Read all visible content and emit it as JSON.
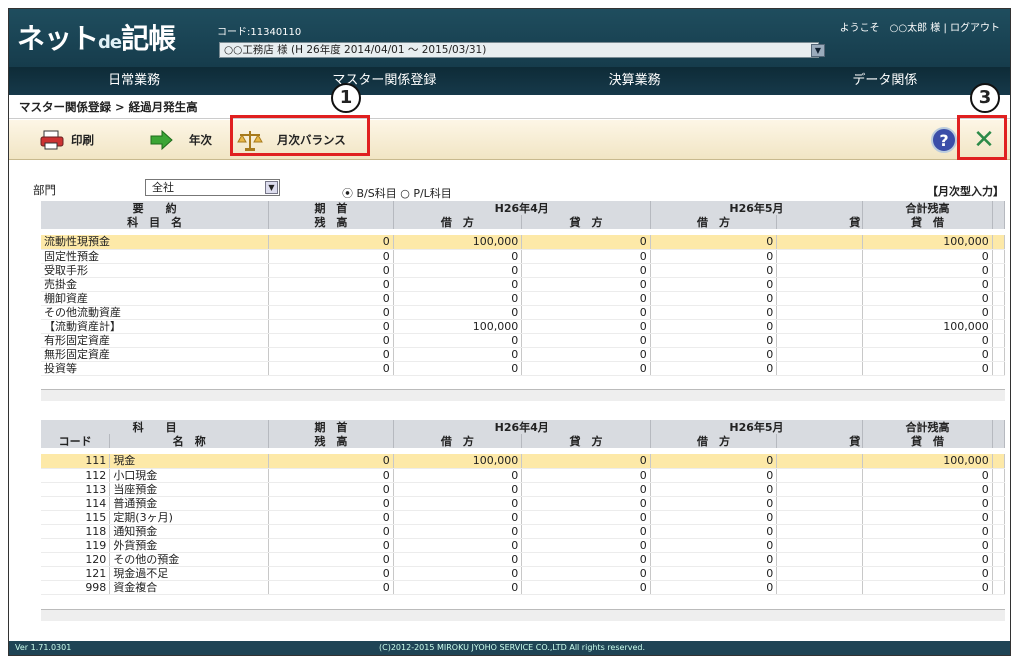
{
  "header": {
    "logo_main": "ネット",
    "logo_de": "de",
    "logo_tail": "記帳",
    "code": "コード:11340110",
    "company": "○○工務店 様 (H 26年度 2014/04/01 〜 2015/03/31)",
    "welcome": "ようこそ　○○太郎 様 | ログアウト"
  },
  "menu": [
    "日常業務",
    "マスター関係登録",
    "決算業務",
    "データ関係"
  ],
  "breadcrumb": "マスター関係登録 > 経過月発生高",
  "toolbar": {
    "print": "印刷",
    "year": "年次",
    "month_balance": "月次バランス",
    "help_icon": "?",
    "close_icon": "✕"
  },
  "callouts": {
    "one": "1",
    "three": "3"
  },
  "filter": {
    "dept_label": "部門",
    "dept_value": "全社",
    "radio_bs": "B/S科目",
    "radio_pl": "P/L科目",
    "mode": "【月次型入力】"
  },
  "top_table": {
    "h1": [
      "要　　約",
      "期　首",
      "H26年4月",
      "H26年5月",
      "合計残高"
    ],
    "h2": [
      "科　目　名",
      "残　高",
      "借　方",
      "貸　方",
      "借　方",
      "貸",
      "貸　借"
    ],
    "rows": [
      [
        "流動性現預金",
        "0",
        "100,000",
        "0",
        "0",
        "100,000"
      ],
      [
        "固定性預金",
        "0",
        "0",
        "0",
        "0",
        "0"
      ],
      [
        "受取手形",
        "0",
        "0",
        "0",
        "0",
        "0"
      ],
      [
        "売掛金",
        "0",
        "0",
        "0",
        "0",
        "0"
      ],
      [
        "棚卸資産",
        "0",
        "0",
        "0",
        "0",
        "0"
      ],
      [
        "その他流動資産",
        "0",
        "0",
        "0",
        "0",
        "0"
      ],
      [
        "【流動資産計】",
        "0",
        "100,000",
        "0",
        "0",
        "100,000"
      ],
      [
        "有形固定資産",
        "0",
        "0",
        "0",
        "0",
        "0"
      ],
      [
        "無形固定資産",
        "0",
        "0",
        "0",
        "0",
        "0"
      ],
      [
        "投資等",
        "0",
        "0",
        "0",
        "0",
        "0"
      ]
    ]
  },
  "bottom_table": {
    "h1": [
      "科　　目",
      "期　首",
      "H26年4月",
      "H26年5月",
      "合計残高"
    ],
    "h2": [
      "コード",
      "名　称",
      "残　高",
      "借　方",
      "貸　方",
      "借　方",
      "貸",
      "貸　借"
    ],
    "rows": [
      [
        "111",
        "現金",
        "0",
        "100,000",
        "0",
        "0",
        "100,000"
      ],
      [
        "112",
        "小口現金",
        "0",
        "0",
        "0",
        "0",
        "0"
      ],
      [
        "113",
        "当座預金",
        "0",
        "0",
        "0",
        "0",
        "0"
      ],
      [
        "114",
        "普通預金",
        "0",
        "0",
        "0",
        "0",
        "0"
      ],
      [
        "115",
        "定期(3ヶ月)",
        "0",
        "0",
        "0",
        "0",
        "0"
      ],
      [
        "118",
        "通知預金",
        "0",
        "0",
        "0",
        "0",
        "0"
      ],
      [
        "119",
        "外貨預金",
        "0",
        "0",
        "0",
        "0",
        "0"
      ],
      [
        "120",
        "その他の預金",
        "0",
        "0",
        "0",
        "0",
        "0"
      ],
      [
        "121",
        "現金過不足",
        "0",
        "0",
        "0",
        "0",
        "0"
      ],
      [
        "998",
        "資金複合",
        "0",
        "0",
        "0",
        "0",
        "0"
      ]
    ]
  },
  "footer": {
    "version": "Ver 1.71.0301",
    "copyright": "(C)2012-2015 MIROKU JYOHO SERVICE CO.,LTD All rights reserved."
  }
}
